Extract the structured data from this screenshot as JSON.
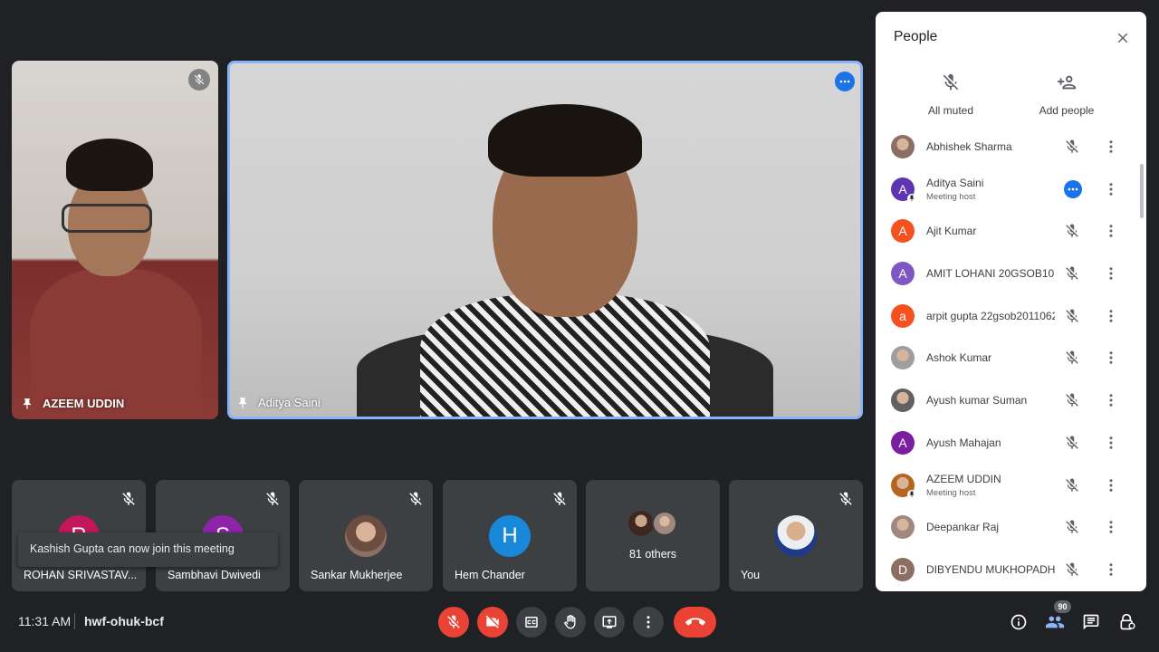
{
  "tiles": {
    "azeem": {
      "name": "AZEEM UDDIN"
    },
    "aditya": {
      "name": "Aditya Saini"
    }
  },
  "bottom_tiles": [
    {
      "name": "ROHAN SRIVASTAV...",
      "initial": "R",
      "color": "#c2185b"
    },
    {
      "name": "Sambhavi Dwivedi",
      "initial": "S",
      "color": "#8e24aa"
    },
    {
      "name": "Sankar Mukherjee"
    },
    {
      "name": "Hem Chander",
      "initial": "H",
      "color": "#1a88d8"
    },
    {
      "label": "81 others"
    },
    {
      "name": "You"
    }
  ],
  "toast": {
    "text": "Kashish Gupta can now join this meeting"
  },
  "meeting": {
    "time": "11:31 AM",
    "code": "hwf-ohuk-bcf"
  },
  "controls": {
    "mic": "mic-off-icon",
    "camera": "camera-off-icon",
    "captions": "captions-icon",
    "hand": "raise-hand-icon",
    "present": "present-icon",
    "more": "more-options-icon",
    "end": "end-call-icon"
  },
  "right_controls": {
    "participants_count": "90"
  },
  "panel": {
    "title": "People",
    "all_muted": "All muted",
    "add_people": "Add people",
    "people": [
      {
        "name": "Abhishek Sharma",
        "sub": "",
        "initial": "",
        "color": "#8d6e63"
      },
      {
        "name": "Aditya Saini",
        "sub": "Meeting host",
        "initial": "A",
        "color": "#5e35b1"
      },
      {
        "name": "Ajit Kumar",
        "sub": "",
        "initial": "A",
        "color": "#f4511e"
      },
      {
        "name": "AMIT LOHANI 20GSOB10...",
        "sub": "",
        "initial": "A",
        "color": "#7e57c2"
      },
      {
        "name": "arpit gupta 22gsob2011062",
        "sub": "",
        "initial": "a",
        "color": "#f4511e"
      },
      {
        "name": "Ashok Kumar",
        "sub": "",
        "initial": "",
        "color": "#9e9e9e"
      },
      {
        "name": "Ayush kumar Suman",
        "sub": "",
        "initial": "",
        "color": "#616161"
      },
      {
        "name": "Ayush Mahajan",
        "sub": "",
        "initial": "A",
        "color": "#7b1fa2"
      },
      {
        "name": "AZEEM UDDIN",
        "sub": "Meeting host",
        "initial": "",
        "color": "#b5651d"
      },
      {
        "name": "Deepankar Raj",
        "sub": "",
        "initial": "",
        "color": "#a1887f"
      },
      {
        "name": "DIBYENDU MUKHOPADH...",
        "sub": "",
        "initial": "D",
        "color": "#8d6e63"
      }
    ]
  }
}
